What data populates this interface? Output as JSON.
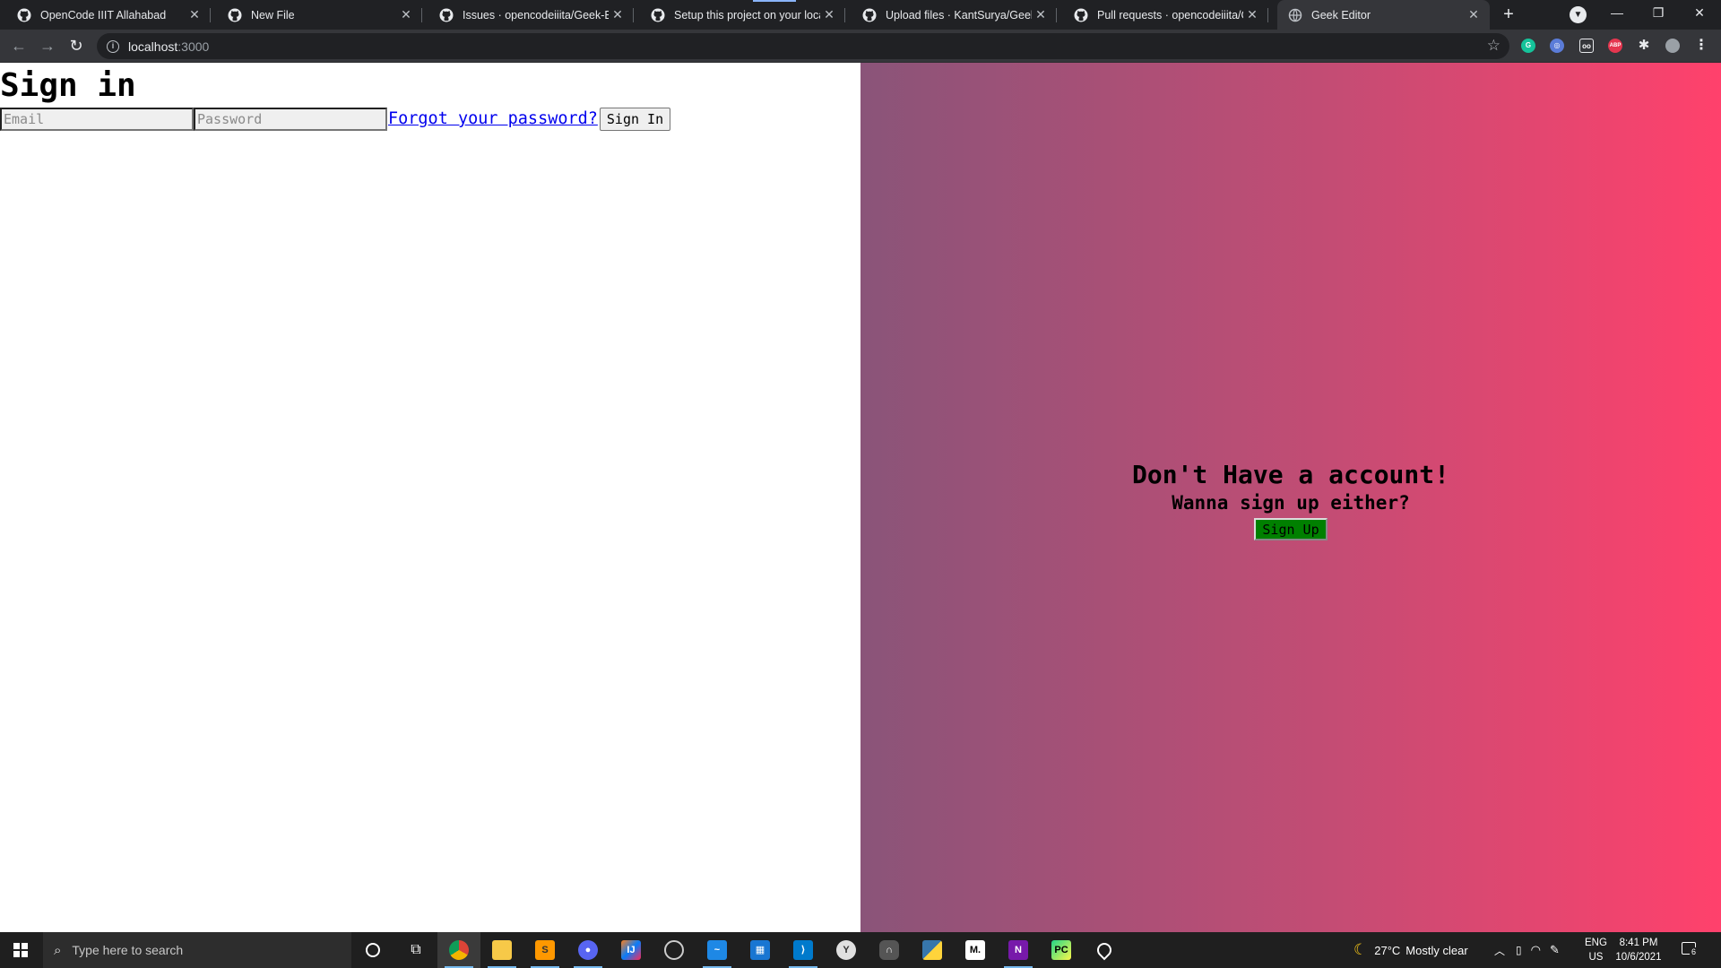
{
  "browser": {
    "tabs": [
      {
        "title": "OpenCode IIIT Allahabad",
        "active": false
      },
      {
        "title": "New File",
        "active": false
      },
      {
        "title": "Issues · opencodeiiita/Geek-Editor",
        "active": false
      },
      {
        "title": "Setup this project on your local machine",
        "active": false
      },
      {
        "title": "Upload files · KantSurya/Geek-Editor",
        "active": false
      },
      {
        "title": "Pull requests · opencodeiiita/Geek-Editor",
        "active": false
      },
      {
        "title": "Geek Editor",
        "active": true
      }
    ],
    "new_tab_label": "+",
    "close_glyph": "✕",
    "url_host": "localhost",
    "url_port": ":3000"
  },
  "signin": {
    "title": "Sign in",
    "email_placeholder": "Email",
    "password_placeholder": "Password",
    "forgot_link": "Forgot your password?",
    "submit_label": "Sign In"
  },
  "signup_panel": {
    "heading": "Don't Have a account!",
    "subheading": "Wanna sign up either?",
    "button_label": "Sign Up",
    "gradient": [
      "#8a5479",
      "#ff416c"
    ],
    "button_color": "#008000"
  },
  "taskbar": {
    "search_placeholder": "Type here to search",
    "weather_temp": "27°C",
    "weather_text": "Mostly clear",
    "lang_primary": "ENG",
    "lang_secondary": "US",
    "time": "8:41 PM",
    "date": "10/6/2021",
    "notification_count": "6",
    "apps": [
      "cortana-icon",
      "task-view-icon",
      "chrome-icon",
      "file-explorer-icon",
      "sublime-text-icon",
      "discord-icon",
      "intellij-icon",
      "obs-icon",
      "whiteboard-icon",
      "calendar-icon",
      "vscode-icon",
      "github-desktop-icon",
      "headphones-app-icon",
      "python-icon",
      "medium-icon",
      "onenote-icon",
      "pycharm-icon",
      "maps-icon"
    ]
  }
}
